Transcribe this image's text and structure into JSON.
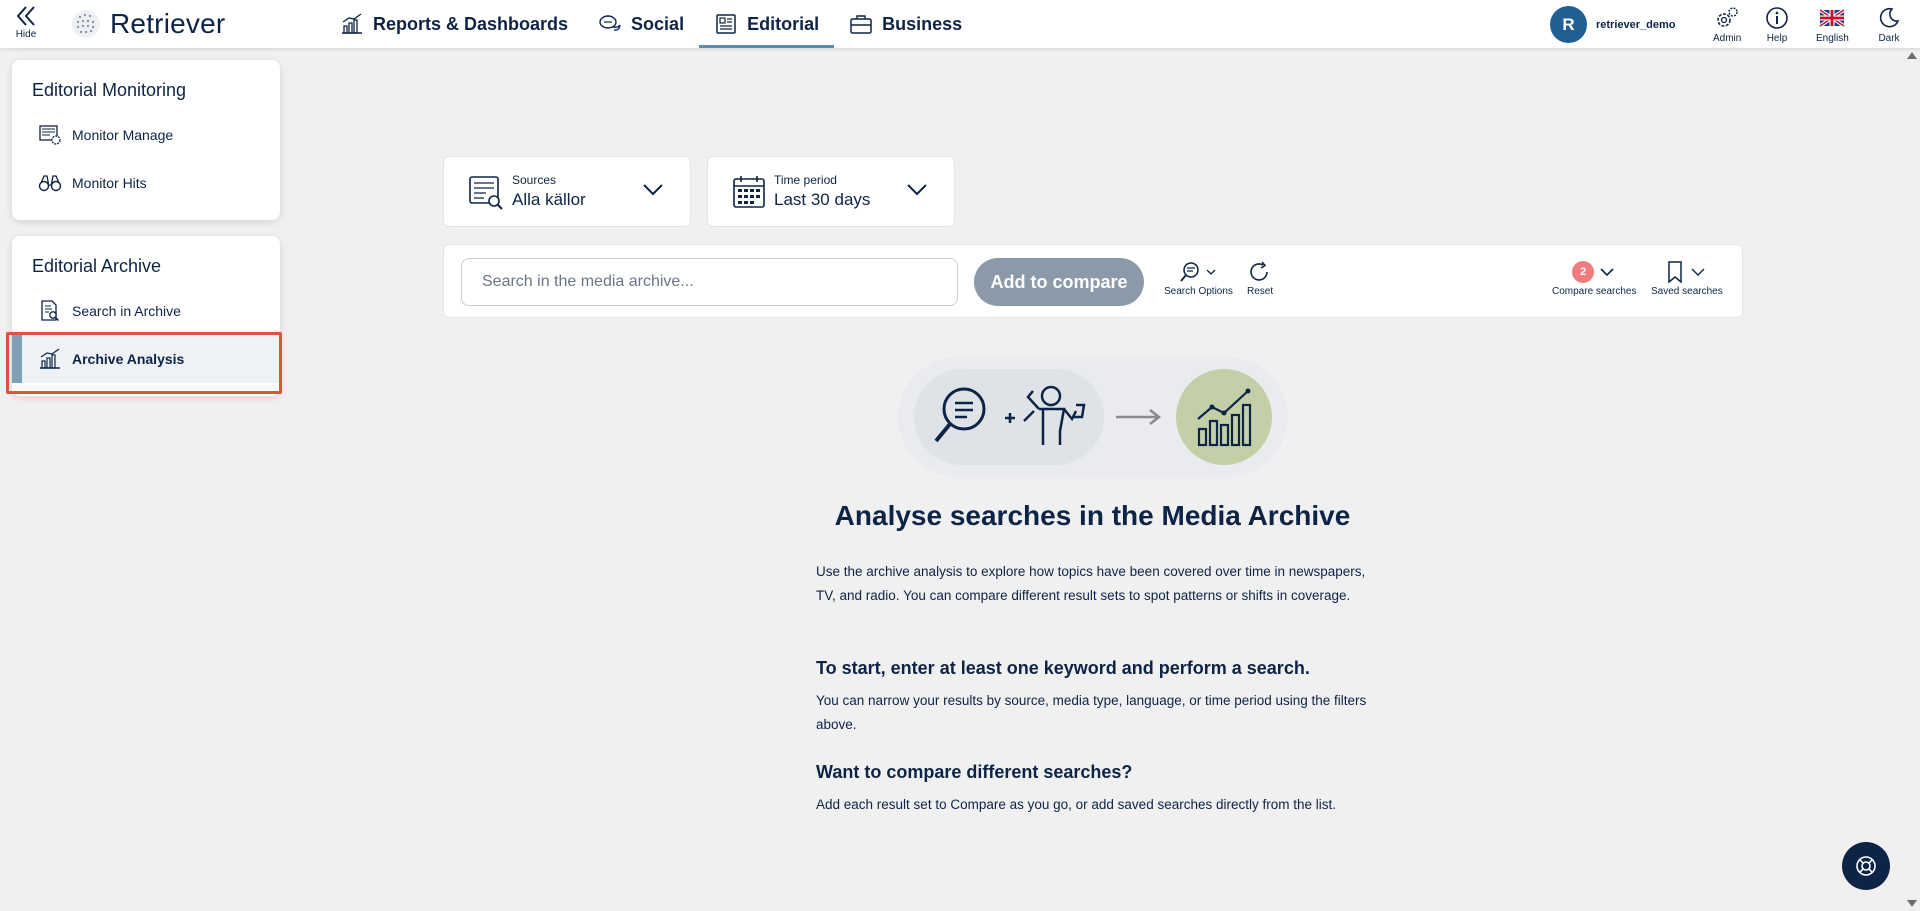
{
  "topbar": {
    "hide_label": "Hide",
    "brand": "Retriever",
    "nav": [
      {
        "label": "Reports & Dashboards",
        "icon": "chart-bars-icon"
      },
      {
        "label": "Social",
        "icon": "chat-bubbles-icon"
      },
      {
        "label": "Editorial",
        "icon": "newspaper-icon",
        "active": true
      },
      {
        "label": "Business",
        "icon": "briefcase-icon"
      }
    ],
    "user": {
      "initial": "R",
      "name": "retriever_demo"
    },
    "tools": {
      "admin": "Admin",
      "help": "Help",
      "language": "English",
      "theme": "Dark"
    }
  },
  "sidebar": {
    "monitoring": {
      "title": "Editorial Monitoring",
      "items": [
        {
          "label": "Monitor Manage",
          "icon": "monitor-settings-icon"
        },
        {
          "label": "Monitor Hits",
          "icon": "binoculars-icon"
        }
      ]
    },
    "archive": {
      "title": "Editorial Archive",
      "items": [
        {
          "label": "Search in Archive",
          "icon": "document-search-icon"
        },
        {
          "label": "Archive Analysis",
          "icon": "chart-bars-icon",
          "active": true
        }
      ]
    }
  },
  "filters": {
    "sources": {
      "label": "Sources",
      "value": "Alla källor"
    },
    "time": {
      "label": "Time period",
      "value": "Last 30 days"
    }
  },
  "search": {
    "placeholder": "Search in the media archive...",
    "add_to_compare": "Add to compare",
    "search_options": "Search Options",
    "reset": "Reset",
    "compare_searches": "Compare searches",
    "compare_count": "2",
    "saved_searches": "Saved searches"
  },
  "main": {
    "title": "Analyse searches in the Media Archive",
    "intro": "Use the archive analysis to explore how topics have been covered over time in newspapers, TV, and radio. You can compare different result sets to spot patterns or shifts in coverage.",
    "start_heading": "To start, enter at least one keyword and perform a search.",
    "start_text": "You can narrow your results by source, media type, language, or time period using the filters above.",
    "compare_heading": "Want to compare different searches?",
    "compare_text": "Add each result set to Compare as you go, or add saved searches directly from the list."
  },
  "colors": {
    "navy": "#0d2446",
    "accent": "#5a8fb5",
    "badge": "#f27c7c",
    "highlight": "#d9553c"
  }
}
